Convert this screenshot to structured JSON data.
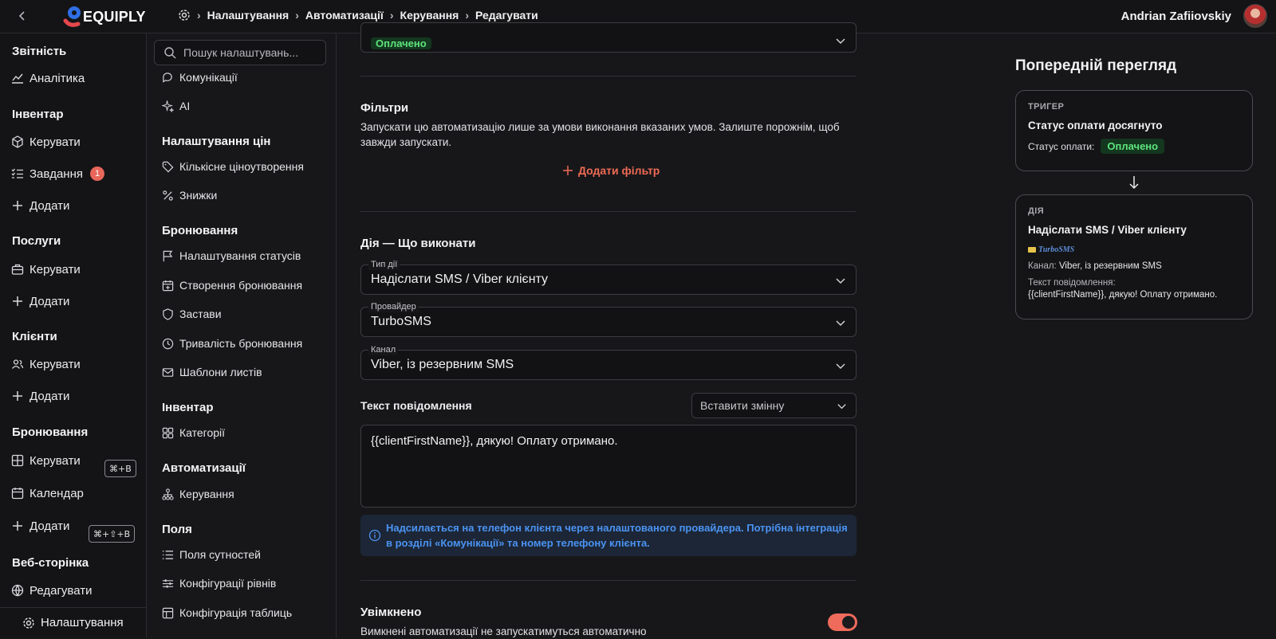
{
  "app": {
    "logo_text": "EQUIPLY"
  },
  "breadcrumb": [
    "Налаштування",
    "Автоматизації",
    "Керування",
    "Редагувати"
  ],
  "user": {
    "name": "Andrian Zafiiovskiy"
  },
  "sidebar": {
    "sections": [
      {
        "title": "Звітність",
        "items": [
          {
            "label": "Аналітика",
            "icon": "chart-line-icon"
          }
        ]
      },
      {
        "title": "Інвентар",
        "items": [
          {
            "label": "Керувати",
            "icon": "cube-icon"
          },
          {
            "label": "Завдання",
            "icon": "list-check-icon",
            "badge": "1"
          },
          {
            "label": "Додати",
            "icon": "plus-icon"
          }
        ]
      },
      {
        "title": "Послуги",
        "items": [
          {
            "label": "Керувати",
            "icon": "briefcase-icon"
          },
          {
            "label": "Додати",
            "icon": "plus-icon"
          }
        ]
      },
      {
        "title": "Клієнти",
        "items": [
          {
            "label": "Керувати",
            "icon": "users-icon"
          },
          {
            "label": "Додати",
            "icon": "plus-icon"
          }
        ]
      },
      {
        "title": "Бронювання",
        "items": [
          {
            "label": "Керувати",
            "icon": "grid-icon",
            "shortcut": "⌘+B"
          },
          {
            "label": "Календар",
            "icon": "calendar-icon"
          },
          {
            "label": "Додати",
            "icon": "plus-icon",
            "shortcut": "⌘+⇧+B"
          }
        ]
      },
      {
        "title": "Веб-сторінка",
        "items": [
          {
            "label": "Редагувати",
            "icon": "globe-icon"
          }
        ]
      }
    ],
    "bottom": {
      "label": "Налаштування",
      "icon": "gear-icon"
    }
  },
  "settings_nav": {
    "search_placeholder": "Пошук налаштувань...",
    "top_items": [
      {
        "label": "Комунікації",
        "icon": "chat-icon"
      },
      {
        "label": "AI",
        "icon": "sparkle-icon"
      }
    ],
    "groups": [
      {
        "title": "Налаштування цін",
        "items": [
          {
            "label": "Кількісне ціноутворення",
            "icon": "tag-icon"
          },
          {
            "label": "Знижки",
            "icon": "percent-icon"
          }
        ]
      },
      {
        "title": "Бронювання",
        "items": [
          {
            "label": "Налаштування статусів",
            "icon": "flag-icon"
          },
          {
            "label": "Створення бронювання",
            "icon": "calendar-plus-icon"
          },
          {
            "label": "Застави",
            "icon": "shield-icon"
          },
          {
            "label": "Тривалість бронювання",
            "icon": "clock-icon"
          },
          {
            "label": "Шаблони листів",
            "icon": "mail-icon"
          }
        ]
      },
      {
        "title": "Інвентар",
        "items": [
          {
            "label": "Категорії",
            "icon": "grid-icon"
          }
        ]
      },
      {
        "title": "Автоматизації",
        "items": [
          {
            "label": "Керування",
            "icon": "workflow-icon"
          }
        ]
      },
      {
        "title": "Поля",
        "items": [
          {
            "label": "Поля сутностей",
            "icon": "list-icon"
          },
          {
            "label": "Конфігурації рівнів",
            "icon": "sliders-icon"
          },
          {
            "label": "Конфігурація таблиць",
            "icon": "table-icon"
          }
        ]
      }
    ]
  },
  "form": {
    "status_value": "Оплачено",
    "filters": {
      "title": "Фільтри",
      "description": "Запускати цю автоматизацію лише за умови виконання вказаних умов. Залиште порожнім, щоб завжди запускати.",
      "add_label": "Додати фільтр"
    },
    "action": {
      "title": "Дія — Що виконати",
      "type_label": "Тип дії",
      "type_value": "Надіслати SMS / Viber клієнту",
      "provider_label": "Провайдер",
      "provider_value": "TurboSMS",
      "channel_label": "Канал",
      "channel_value": "Viber, із резервним SMS",
      "message_label": "Текст повідомлення",
      "insert_variable": "Вставити змінну",
      "message_value": "{{clientFirstName}}, дякую! Оплату отримано.",
      "info": "Надсилається на телефон клієнта через налаштованого провайдера. Потрібна інтеграція в розділі «Комунікації» та номер телефону клієнта."
    },
    "enabled": {
      "title": "Увімкнено",
      "description": "Вимкнені автоматизації не запускатимуться автоматично",
      "value": true
    }
  },
  "preview": {
    "title": "Попередній перегляд",
    "trigger": {
      "kicker": "ТРИГЕР",
      "title": "Статус оплати досягнуто",
      "status_label": "Статус оплати:",
      "status_value": "Оплачено"
    },
    "action": {
      "kicker": "ДІЯ",
      "title": "Надіслати SMS / Viber клієнту",
      "provider_logo": "TurboSMS",
      "channel_label": "Канал:",
      "channel_value": "Viber, із резервним SMS",
      "message_label": "Текст повідомлення:",
      "message_value": "{{clientFirstName}}, дякую! Оплату отримано."
    }
  },
  "colors": {
    "accent": "#ef6b5b",
    "success_text": "#5ee37c",
    "info_text": "#4b93f2",
    "background": "#17171a"
  }
}
